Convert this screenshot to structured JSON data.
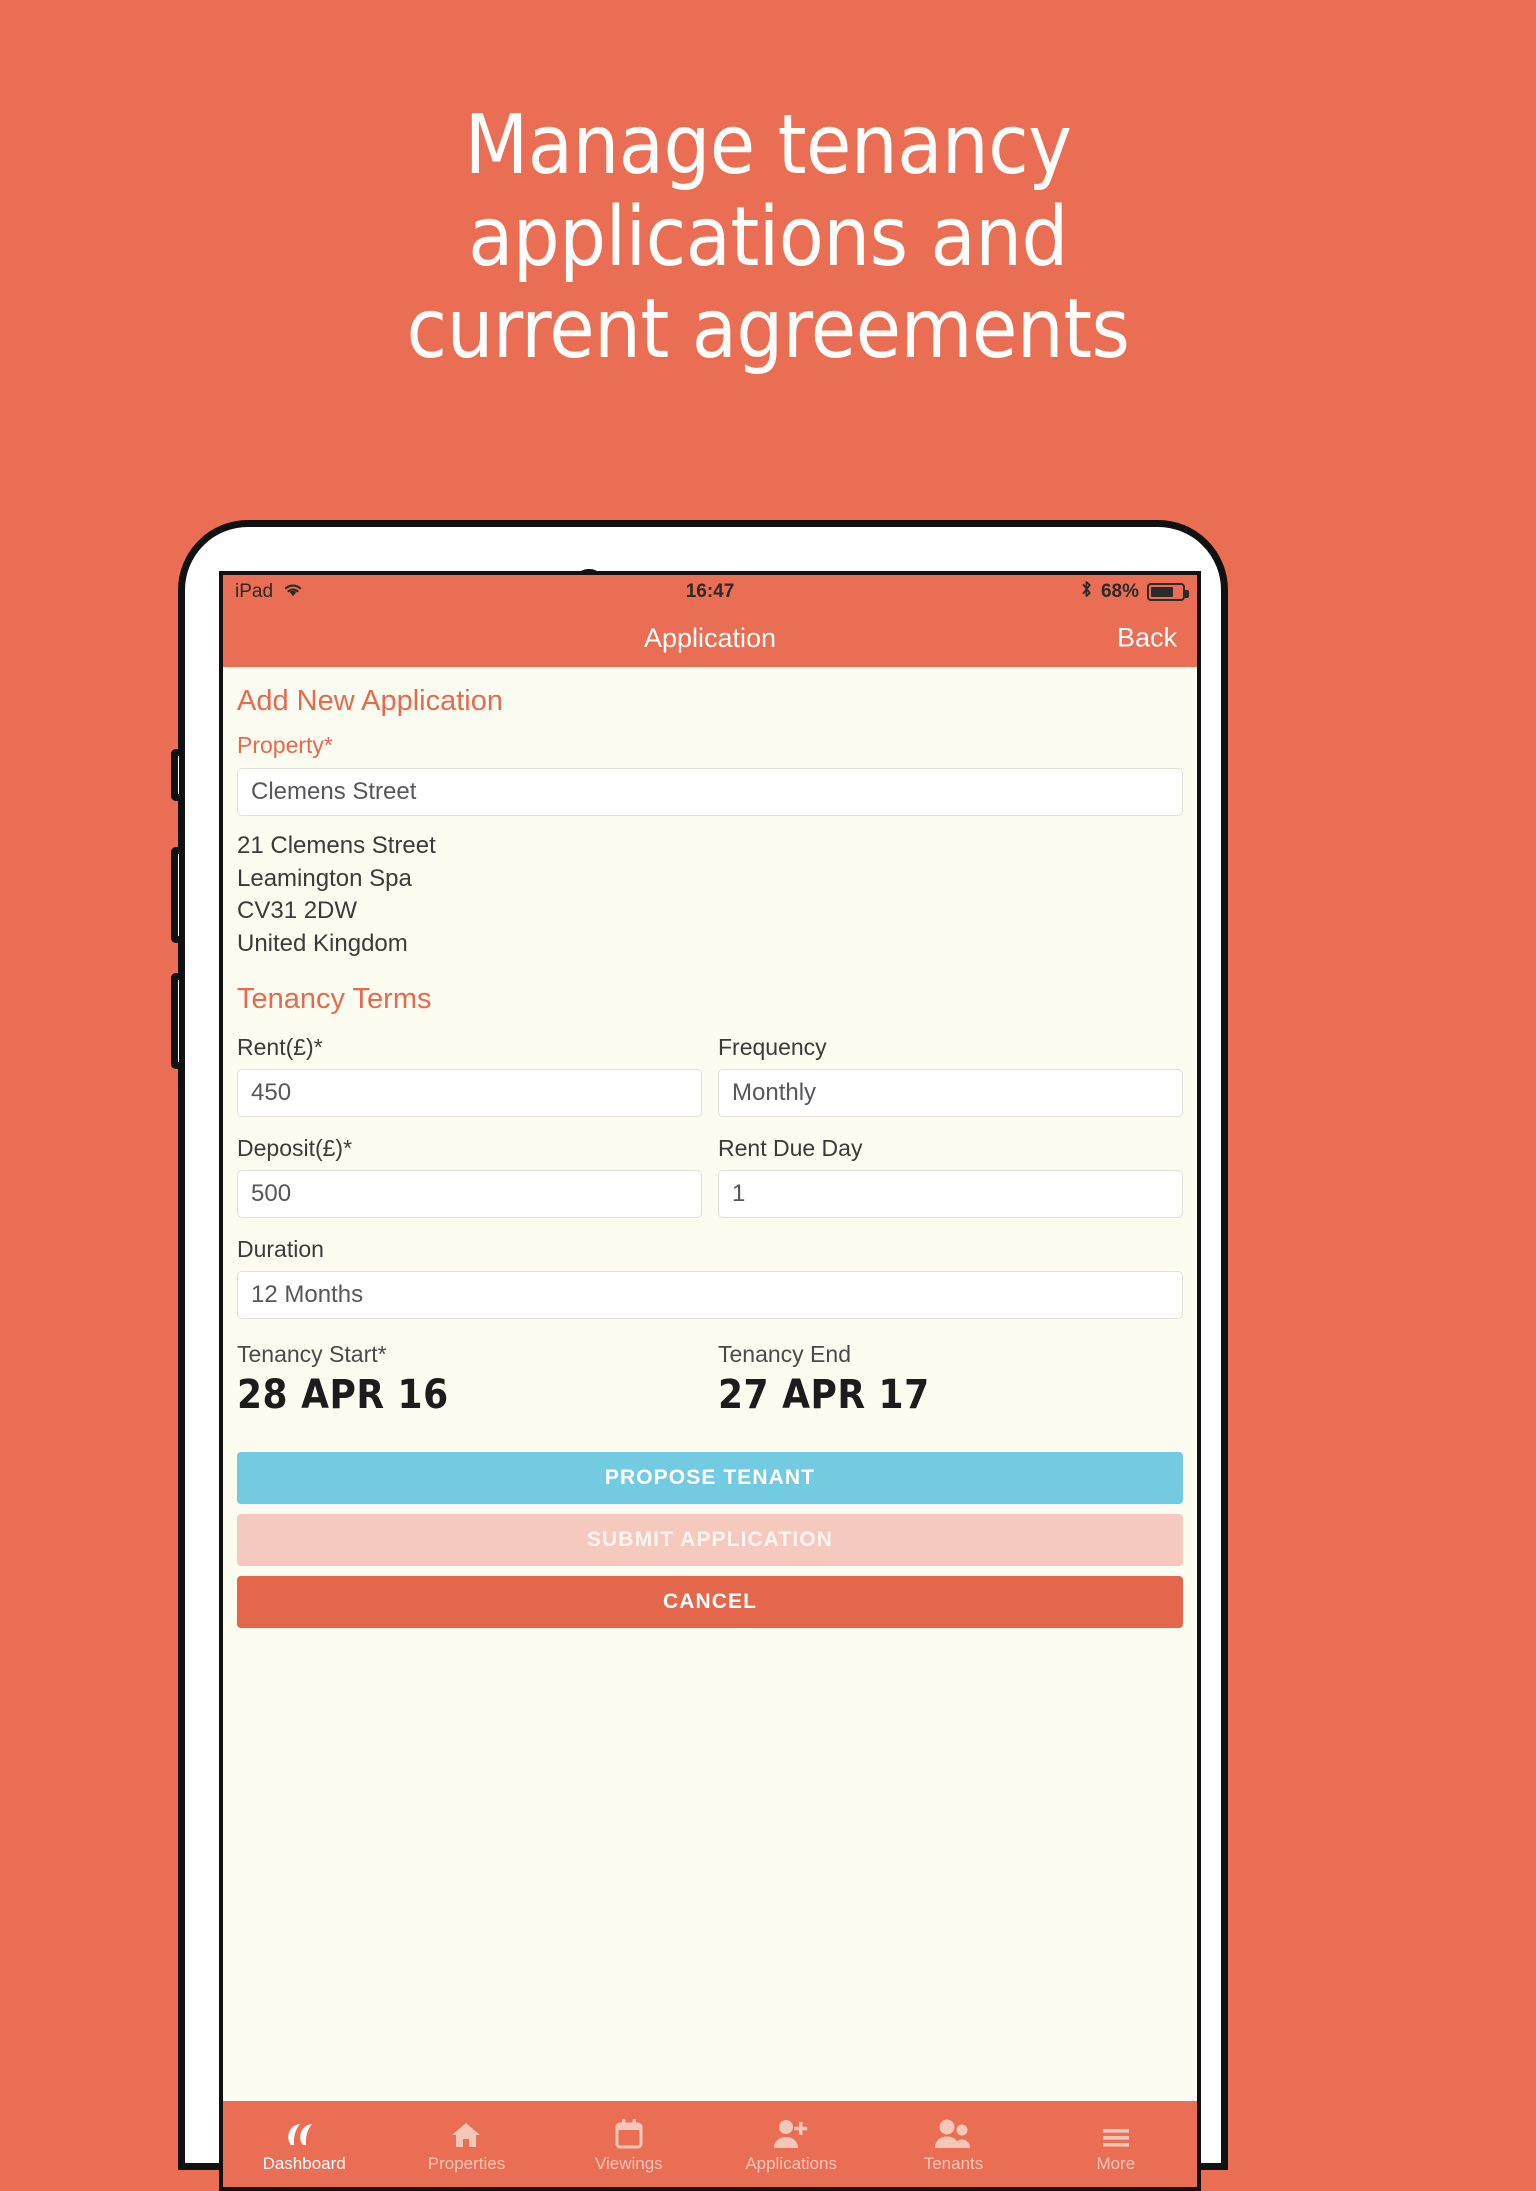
{
  "marketing": {
    "headline_lines": [
      "Manage tenancy",
      "applications and",
      "current agreements"
    ],
    "background_color": "#e96e53"
  },
  "status_bar": {
    "carrier": "iPad",
    "wifi_icon": "wifi-icon",
    "time": "16:47",
    "bluetooth_icon": "bluetooth-icon",
    "battery_percent": "68%",
    "battery_icon": "battery-icon"
  },
  "nav_bar": {
    "title": "Application",
    "back_label": "Back"
  },
  "form": {
    "heading": "Add New Application",
    "property": {
      "label": "Property*",
      "value": "Clemens Street",
      "address_lines": [
        "21 Clemens Street",
        "Leamington Spa",
        "CV31 2DW",
        "United Kingdom"
      ]
    },
    "tenancy_terms_title": "Tenancy Terms",
    "fields": {
      "rent": {
        "label": "Rent(£)*",
        "value": "450"
      },
      "frequency": {
        "label": "Frequency",
        "value": "Monthly"
      },
      "deposit": {
        "label": "Deposit(£)*",
        "value": "500"
      },
      "rent_due_day": {
        "label": "Rent Due Day",
        "value": "1"
      },
      "duration": {
        "label": "Duration",
        "value": "12 Months"
      }
    },
    "dates": {
      "start": {
        "label": "Tenancy Start*",
        "value": "28 APR 16"
      },
      "end": {
        "label": "Tenancy End",
        "value": "27 APR 17"
      }
    },
    "actions": {
      "propose": "PROPOSE TENANT",
      "submit": "SUBMIT APPLICATION",
      "cancel": "CANCEL"
    }
  },
  "tab_bar": {
    "items": [
      {
        "label": "Dashboard",
        "icon": "dashboard-icon",
        "active": true
      },
      {
        "label": "Properties",
        "icon": "home-icon",
        "active": false
      },
      {
        "label": "Viewings",
        "icon": "calendar-icon",
        "active": false
      },
      {
        "label": "Applications",
        "icon": "person-add-icon",
        "active": false
      },
      {
        "label": "Tenants",
        "icon": "people-icon",
        "active": false
      },
      {
        "label": "More",
        "icon": "hamburger-icon",
        "active": false
      }
    ]
  },
  "colors": {
    "brand": "#e96e53",
    "accent_text": "#e46a50",
    "screen_bg": "#fdfcf0",
    "propose_button": "#72cbe0",
    "submit_button": "#f5c9bd",
    "cancel_button": "#e4664b"
  }
}
